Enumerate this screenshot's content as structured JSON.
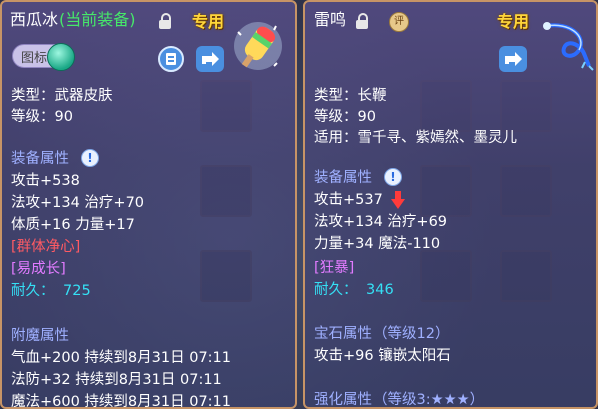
{
  "left": {
    "name": "西瓜冰",
    "equipped_tag": "(当前装备)",
    "exclusive": "专用",
    "icon_toggle_label": "图标",
    "type_line": "类型：武器皮肤",
    "level_line": "等级：90",
    "equip_attr_title": "装备属性",
    "stats": [
      "攻击+538",
      "法攻+134 治疗+70",
      "体质+16 力量+17"
    ],
    "special1": "[群体净心]",
    "special2": "[易成长]",
    "durability_label": "耐久：",
    "durability_value": "725",
    "enchant_title": "附魔属性",
    "enchants": [
      "气血+200 持续到8月31日 07:11",
      "法防+32 持续到8月31日 07:11",
      "魔法+600 持续到8月31日 07:11"
    ]
  },
  "right": {
    "name": "雷鸣",
    "ping_badge": "评",
    "exclusive": "专用",
    "type_line": "类型：长鞭",
    "level_line": "等级：90",
    "suitable_line": "适用：雪千寻、紫嫣然、墨灵儿",
    "equip_attr_title": "装备属性",
    "stats": [
      "攻击+537",
      "法攻+134 治疗+69",
      "力量+34 魔法-110"
    ],
    "special1": "[狂暴]",
    "durability_label": "耐久：",
    "durability_value": "346",
    "gem_title": "宝石属性",
    "gem_level": "（等级12）",
    "gem_line": "攻击+96 镶嵌太阳石",
    "enhance_title": "强化属性",
    "enhance_level": "（等级3:★★★）"
  },
  "colors": {
    "border": "#c79466",
    "section": "#9fb0ff",
    "red": "#ff5a63",
    "pink": "#e17bff",
    "cyan": "#35e0f5",
    "gold": "#ffd447"
  }
}
